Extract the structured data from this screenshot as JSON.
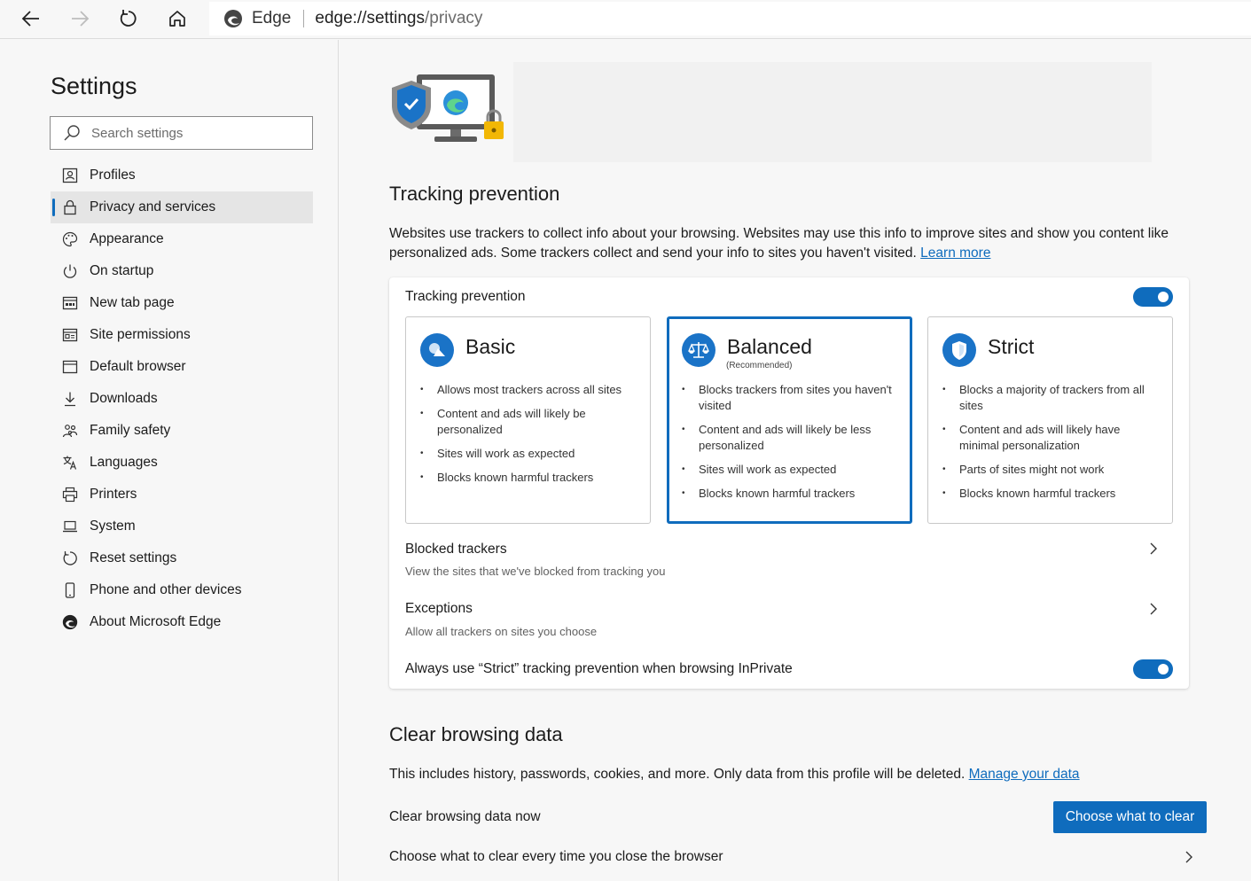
{
  "browser": {
    "brand": "Edge",
    "url_host": "edge://settings",
    "url_path": "/privacy"
  },
  "sidebar": {
    "title": "Settings",
    "search_placeholder": "Search settings",
    "items": [
      {
        "label": "Profiles",
        "icon": "profile-card-icon"
      },
      {
        "label": "Privacy and services",
        "icon": "lock-icon",
        "active": true
      },
      {
        "label": "Appearance",
        "icon": "palette-icon"
      },
      {
        "label": "On startup",
        "icon": "power-icon"
      },
      {
        "label": "New tab page",
        "icon": "new-tab-icon"
      },
      {
        "label": "Site permissions",
        "icon": "site-permissions-icon"
      },
      {
        "label": "Default browser",
        "icon": "browser-window-icon"
      },
      {
        "label": "Downloads",
        "icon": "download-icon"
      },
      {
        "label": "Family safety",
        "icon": "family-icon"
      },
      {
        "label": "Languages",
        "icon": "language-icon"
      },
      {
        "label": "Printers",
        "icon": "printer-icon"
      },
      {
        "label": "System",
        "icon": "laptop-icon"
      },
      {
        "label": "Reset settings",
        "icon": "reset-icon"
      },
      {
        "label": "Phone and other devices",
        "icon": "phone-icon"
      },
      {
        "label": "About Microsoft Edge",
        "icon": "edge-logo-icon"
      }
    ]
  },
  "tracking": {
    "heading": "Tracking prevention",
    "description": "Websites use trackers to collect info about your browsing. Websites may use this info to improve sites and show you content like personalized ads. Some trackers collect and send your info to sites you haven't visited.",
    "learn_more": "Learn more",
    "card_title": "Tracking prevention",
    "enabled": true,
    "levels": [
      {
        "name": "Basic",
        "subtitle": "",
        "selected": false,
        "icon": "basic-level-icon",
        "bullets": [
          "Allows most trackers across all sites",
          "Content and ads will likely be personalized",
          "Sites will work as expected",
          "Blocks known harmful trackers"
        ]
      },
      {
        "name": "Balanced",
        "subtitle": "(Recommended)",
        "selected": true,
        "icon": "balance-scale-icon",
        "bullets": [
          "Blocks trackers from sites you haven't visited",
          "Content and ads will likely be less personalized",
          "Sites will work as expected",
          "Blocks known harmful trackers"
        ]
      },
      {
        "name": "Strict",
        "subtitle": "",
        "selected": false,
        "icon": "shield-icon",
        "bullets": [
          "Blocks a majority of trackers from all sites",
          "Content and ads will likely have minimal personalization",
          "Parts of sites might not work",
          "Blocks known harmful trackers"
        ]
      }
    ],
    "blocked_title": "Blocked trackers",
    "blocked_sub": "View the sites that we've blocked from tracking you",
    "exceptions_title": "Exceptions",
    "exceptions_sub": "Allow all trackers on sites you choose",
    "inprivate_label": "Always use “Strict” tracking prevention when browsing InPrivate",
    "inprivate_enabled": true
  },
  "clear": {
    "heading": "Clear browsing data",
    "description": "This includes history, passwords, cookies, and more. Only data from this profile will be deleted.",
    "manage_link": "Manage your data",
    "now_label": "Clear browsing data now",
    "button_label": "Choose what to clear",
    "every_time_label": "Choose what to clear every time you close the browser"
  },
  "colors": {
    "accent": "#0f6cbd",
    "background": "#f7f7f7",
    "card": "#ffffff"
  }
}
